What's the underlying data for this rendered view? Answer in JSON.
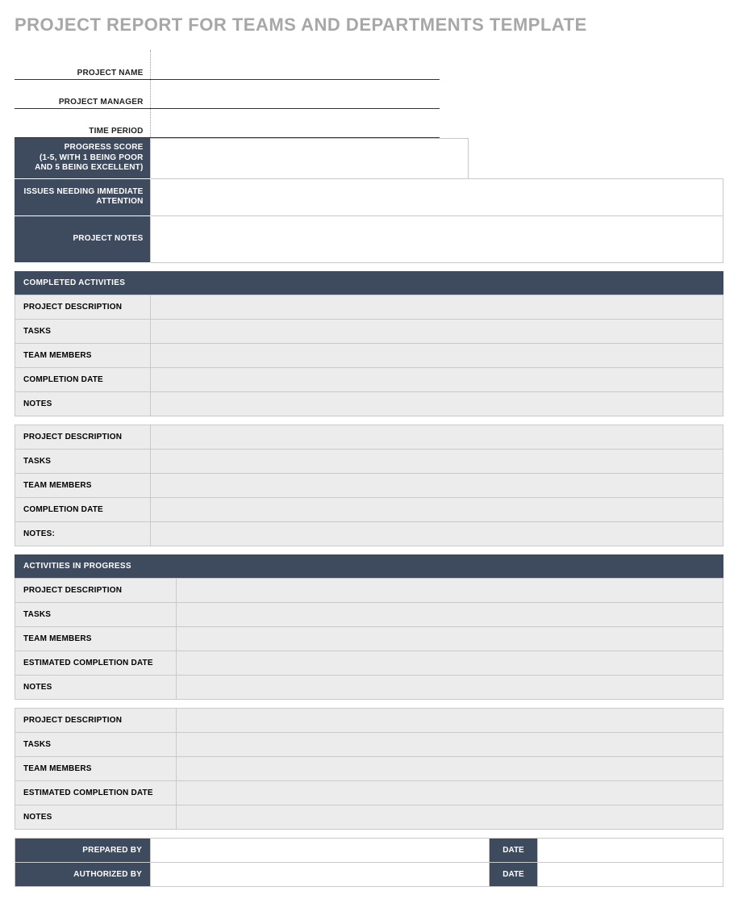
{
  "title": "PROJECT REPORT FOR TEAMS AND DEPARTMENTS TEMPLATE",
  "info": {
    "project_name_label": "PROJECT NAME",
    "project_name_value": "",
    "project_manager_label": "PROJECT MANAGER",
    "project_manager_value": "",
    "time_period_label": "TIME PERIOD",
    "time_period_value": ""
  },
  "stack": {
    "progress_label": "PROGRESS SCORE\n(1-5, WITH 1 BEING POOR AND 5 BEING EXCELLENT)",
    "progress_value": "",
    "issues_label": "ISSUES NEEDING IMMEDIATE ATTENTION",
    "issues_value": "",
    "notes_label": "PROJECT NOTES",
    "notes_value": ""
  },
  "sections": {
    "completed_header": "COMPLETED ACTIVITIES",
    "in_progress_header": "ACTIVITIES IN PROGRESS"
  },
  "completed": [
    {
      "project_description_label": "PROJECT DESCRIPTION",
      "project_description_value": "",
      "tasks_label": "TASKS",
      "tasks_value": "",
      "team_members_label": "TEAM MEMBERS",
      "team_members_value": "",
      "completion_date_label": "COMPLETION DATE",
      "completion_date_value": "",
      "notes_label": "NOTES",
      "notes_value": ""
    },
    {
      "project_description_label": "PROJECT DESCRIPTION",
      "project_description_value": "",
      "tasks_label": "TASKS",
      "tasks_value": "",
      "team_members_label": "TEAM MEMBERS",
      "team_members_value": "",
      "completion_date_label": "COMPLETION DATE",
      "completion_date_value": "",
      "notes_label": "NOTES:",
      "notes_value": ""
    }
  ],
  "in_progress": [
    {
      "project_description_label": "PROJECT DESCRIPTION",
      "project_description_value": "",
      "tasks_label": "TASKS",
      "tasks_value": "",
      "team_members_label": "TEAM MEMBERS",
      "team_members_value": "",
      "completion_date_label": "ESTIMATED COMPLETION DATE",
      "completion_date_value": "",
      "notes_label": "NOTES",
      "notes_value": ""
    },
    {
      "project_description_label": "PROJECT DESCRIPTION",
      "project_description_value": "",
      "tasks_label": "TASKS",
      "tasks_value": "",
      "team_members_label": "TEAM MEMBERS",
      "team_members_value": "",
      "completion_date_label": "ESTIMATED COMPLETION DATE",
      "completion_date_value": "",
      "notes_label": "NOTES",
      "notes_value": ""
    }
  ],
  "signoff": {
    "prepared_by_label": "PREPARED BY",
    "prepared_by_value": "",
    "prepared_date_label": "DATE",
    "prepared_date_value": "",
    "authorized_by_label": "AUTHORIZED BY",
    "authorized_by_value": "",
    "authorized_date_label": "DATE",
    "authorized_date_value": ""
  }
}
